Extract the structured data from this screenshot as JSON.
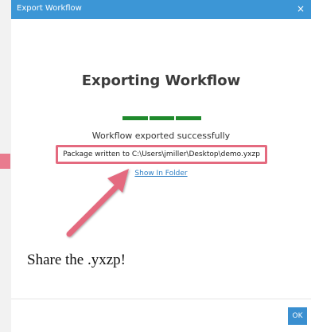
{
  "window": {
    "title": "Export Workflow",
    "close_glyph": "×"
  },
  "content": {
    "heading": "Exporting Workflow",
    "progress_fraction": 1.0,
    "status": "Workflow exported successfully",
    "package_path": "Package written to C:\\Users\\jmiller\\Desktop\\demo.yxzp",
    "show_in_folder_link": "Show In Folder"
  },
  "annotation": {
    "caption": "Share the .yxzp!",
    "arrow_color": "#e46a7f"
  },
  "footer": {
    "ok_label": "OK"
  },
  "colors": {
    "titlebar": "#3c96d6",
    "progress": "#1f8a2c",
    "highlight": "#e46a7f",
    "link": "#2f7fc4"
  }
}
